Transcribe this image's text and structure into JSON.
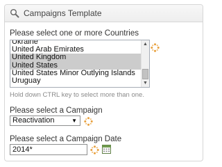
{
  "panel": {
    "title": "Campaigns Template",
    "header_icon": "search-icon"
  },
  "countries": {
    "label": "Please select one or more Countries",
    "options": [
      {
        "label": "Ukraine",
        "selected": false
      },
      {
        "label": "United Arab Emirates",
        "selected": false
      },
      {
        "label": "United Kingdom",
        "selected": true
      },
      {
        "label": "United States",
        "selected": true
      },
      {
        "label": "United States Minor Outlying Islands",
        "selected": false
      },
      {
        "label": "Uruguay",
        "selected": false
      }
    ],
    "hint": "Hold down CTRL key to select more than one.",
    "loading_icon": "spinner-icon"
  },
  "campaign": {
    "label": "Please select a Campaign",
    "selected": "Reactivation",
    "loading_icon": "spinner-icon"
  },
  "campaign_date": {
    "label": "Please select a Campaign Date",
    "value": "2014*",
    "loading_icon": "spinner-icon",
    "picker_icon": "calendar-icon"
  },
  "colors": {
    "border": "#d6d6d6",
    "selected_row": "#cccccc",
    "spinner": "#e8a03c"
  }
}
